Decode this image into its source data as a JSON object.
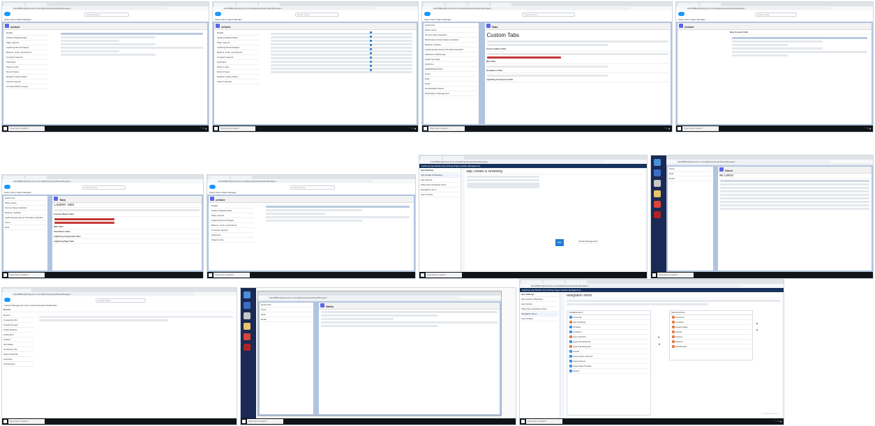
{
  "screens": {
    "s1": {
      "url": "s2ec5f08a.lightning.force.com/lightning/setup/ObjectManager/...",
      "search": "Search Setup",
      "nav": "Setup   Home   Object Manager",
      "object": "Object",
      "title": "vehicle",
      "side": [
        "Details",
        "Fields & Relationships",
        "Page Layouts",
        "Lightning Record Pages",
        "Buttons, Links, and Actions",
        "Compact Layouts",
        "Field Sets",
        "Object Limits",
        "Record Types",
        "Related Lookup Filters",
        "Search Layouts",
        "List View Button Layout",
        "Restriction Rules",
        "Scoping Rules",
        "Object Access",
        "Triggers"
      ],
      "taskbar": "Type here to search"
    },
    "s2": {
      "title": "vehicle",
      "side": [
        "Details",
        "Fields & Relationships",
        "Page Layouts",
        "Lightning Record Pages",
        "Buttons, Links, and Actions",
        "Compact Layouts",
        "Field Sets",
        "Object Limits",
        "Record Types",
        "Related Lookup Filters",
        "Search Layouts"
      ],
      "taskbar": "Type here to search"
    },
    "s3": {
      "object": "Setup",
      "title": "Tabs",
      "page_title": "Custom Tabs",
      "sections": [
        "Custom Object Tabs",
        "Web Tabs",
        "Visualforce Tabs",
        "Lightning Component Tabs"
      ],
      "side": [
        "Quick Find",
        "Setup Home",
        "Service Setup Assistant",
        "Multi-Factor Authentication Assistant",
        "Release Updates",
        "Lightning Experience Transition Assistant",
        "Salesforce Mobile App",
        "Lightning Usage",
        "Optimizer",
        "ADMINISTRATION",
        "Users",
        "Data",
        "Email",
        "PLATFORM TOOLS",
        "Subscription Management"
      ],
      "taskbar": "Type here to search"
    },
    "s4": {
      "object": "Fields",
      "title": "vehicle",
      "page_title": "New Custom Field",
      "taskbar": "Type here to search"
    },
    "s5": {
      "title": "Tabs",
      "page_title": "Custom Tabs",
      "sections": [
        "Custom Object Tabs",
        "Web Tabs",
        "Visualforce Tabs",
        "Lightning Component Tabs",
        "Lightning Page Tabs"
      ],
      "taskbar": "Type here to search"
    },
    "s6": {
      "title": "vehicle",
      "taskbar": "Type here to search"
    },
    "s7": {
      "nav": "Lightning App Builder   App Settings   Pages   Vehicle Management",
      "side": [
        "App Settings",
        "App Details & Branding",
        "App Options",
        "Utility Items (Desktop Only)",
        "Navigation Items",
        "User Profiles"
      ],
      "page_title": "App Details & Branding",
      "tile": "VM",
      "tile_label": "Vehicle Management",
      "taskbar": "Type here to search"
    },
    "s8": {
      "title": "Users",
      "page_title": "All Users",
      "taskbar": "Type here to search"
    },
    "s9": {
      "nav": "Vehicle Management   Home   Vehicle   Reports   Dashboards",
      "object": "Vehicle",
      "title": "Recent",
      "side": [
        "Recent",
        "Created by Me",
        "Private Reports",
        "Public Reports",
        "All Reports",
        "Folders",
        "All Folders",
        "Created by Me",
        "Shared with Me",
        "Favorites",
        "All Favorites"
      ],
      "taskbar": "Type here to search"
    },
    "s10": {
      "object": "Setup",
      "title": "Notes",
      "taskbar": "Type here to search"
    },
    "s11": {
      "nav": "Lightning App Builder   App Settings   Pages   Vehicle Management",
      "side": [
        "App Settings",
        "App Details & Branding",
        "App Options",
        "Utility Items (Desktop Only)",
        "Navigation Items",
        "User Profiles"
      ],
      "page_title": "Navigation Items",
      "available_header": "Available Items",
      "selected_header": "Selected Items",
      "available": [
        "Accounts",
        "Alert Settings",
        "All Sites",
        "Analytics",
        "App Launcher",
        "Approval Requests",
        "Approval Requests",
        "Assets",
        "Asset Action Sources",
        "Asset Actions",
        "Asset State Periods",
        "Assets"
      ],
      "selected": [
        "Accounts",
        "Contacts",
        "Opportunities",
        "Vehicle",
        "Owners",
        "Reports",
        "Dashboards"
      ],
      "watermark": "Activate Windows",
      "taskbar": "Type here to search"
    }
  },
  "colors": {
    "brand": "#1b96ff",
    "nav_dark": "#16325c",
    "content_bg": "#b0c4df",
    "taskbar": "#101418"
  }
}
